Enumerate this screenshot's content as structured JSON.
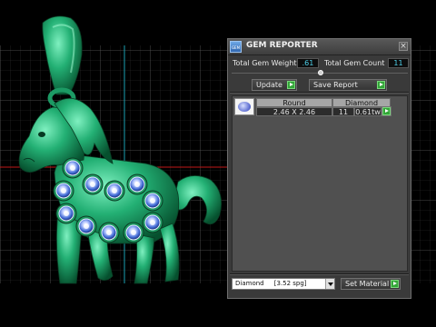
{
  "colors": {
    "background": "#000000",
    "grid": "#4a4a4a",
    "axis_vertical": "#1aa0b0",
    "axis_horizontal": "#c01818",
    "model": "#20a86c",
    "gem": "#3a64d0",
    "value_text": "#4ecfe8",
    "go_button": "#33a638"
  },
  "viewport": {
    "model_description_icon": "horse-pendant-model"
  },
  "panel": {
    "title": "GEM REPORTER",
    "icon": "app-icon",
    "close_icon": "close-icon",
    "total_weight_label": "Total Gem Weight",
    "total_weight_value": ".61",
    "total_count_label": "Total Gem Count",
    "total_count_value": "11",
    "update_label": "Update",
    "save_report_label": "Save Report",
    "table": {
      "headers": [
        "Round",
        "Diamond"
      ],
      "rows": [
        {
          "shape": "Round",
          "size": "2.46 X 2.46",
          "count": "11",
          "weight": "0.61tw"
        }
      ]
    },
    "material_select_value": "Diamond     [3.52 spg]",
    "set_material_label": "Set Material"
  }
}
